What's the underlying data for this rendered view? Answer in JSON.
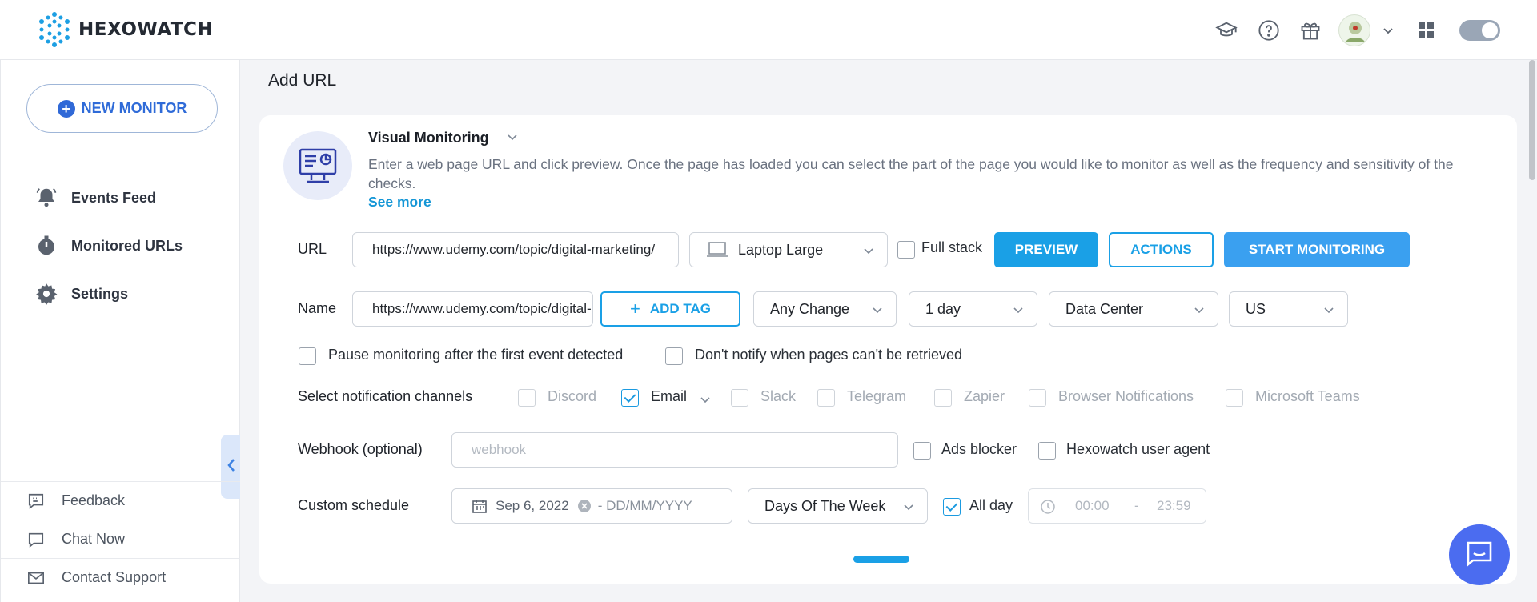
{
  "header": {
    "brand": "HEXOWATCH",
    "icons": [
      "graduation-cap-icon",
      "help-circle-icon",
      "gift-icon",
      "user-avatar",
      "chevron-down-icon",
      "apps-grid-icon",
      "theme-toggle"
    ]
  },
  "sidebar": {
    "new_monitor_label": "NEW MONITOR",
    "nav": [
      {
        "label": "Events Feed",
        "icon": "bell-icon"
      },
      {
        "label": "Monitored URLs",
        "icon": "stopwatch-icon"
      },
      {
        "label": "Settings",
        "icon": "gear-icon"
      }
    ],
    "footer": [
      {
        "label": "Feedback",
        "icon": "feedback-icon"
      },
      {
        "label": "Chat Now",
        "icon": "chat-icon"
      },
      {
        "label": "Contact Support",
        "icon": "mail-icon"
      }
    ]
  },
  "main": {
    "title": "Add URL",
    "monitor": {
      "type": "Visual Monitoring",
      "description": "Enter a web page URL and click preview. Once the page has loaded you can select the part of the page you would like to monitor as well as the frequency and sensitivity of the checks.",
      "see_more": "See more"
    },
    "url_row": {
      "label": "URL",
      "value": "https://www.udemy.com/topic/digital-marketing/",
      "device": "Laptop Large",
      "full_stack": "Full stack",
      "preview": "PREVIEW",
      "actions": "ACTIONS",
      "start": "START MONITORING"
    },
    "name_row": {
      "label": "Name",
      "value": "https://www.udemy.com/topic/digital-marketing/",
      "add_tag": "ADD TAG",
      "change_type": "Any Change",
      "frequency": "1 day",
      "location_type": "Data Center",
      "country": "US"
    },
    "options": {
      "pause_after_first": "Pause monitoring after the first event detected",
      "dont_notify": "Don't notify when pages can't be retrieved"
    },
    "notifications": {
      "label": "Select notification channels",
      "channels": [
        {
          "name": "Discord",
          "checked": false
        },
        {
          "name": "Email",
          "checked": true
        },
        {
          "name": "Slack",
          "checked": false
        },
        {
          "name": "Telegram",
          "checked": false
        },
        {
          "name": "Zapier",
          "checked": false
        },
        {
          "name": "Browser Notifications",
          "checked": false
        },
        {
          "name": "Microsoft Teams",
          "checked": false
        }
      ]
    },
    "webhook": {
      "label": "Webhook (optional)",
      "placeholder": "webhook",
      "ads_blocker": "Ads blocker",
      "user_agent": "Hexowatch user agent"
    },
    "schedule": {
      "label": "Custom schedule",
      "start_date": "Sep 6, 2022",
      "end_placeholder": "- DD/MM/YYYY",
      "days": "Days Of The Week",
      "all_day": "All day",
      "time_from": "00:00",
      "time_sep": "-",
      "time_to": "23:59"
    }
  },
  "colors": {
    "accent": "#1aa0e6",
    "brand_blue": "#3069d7",
    "chat_bubble": "#4b6cf0"
  }
}
